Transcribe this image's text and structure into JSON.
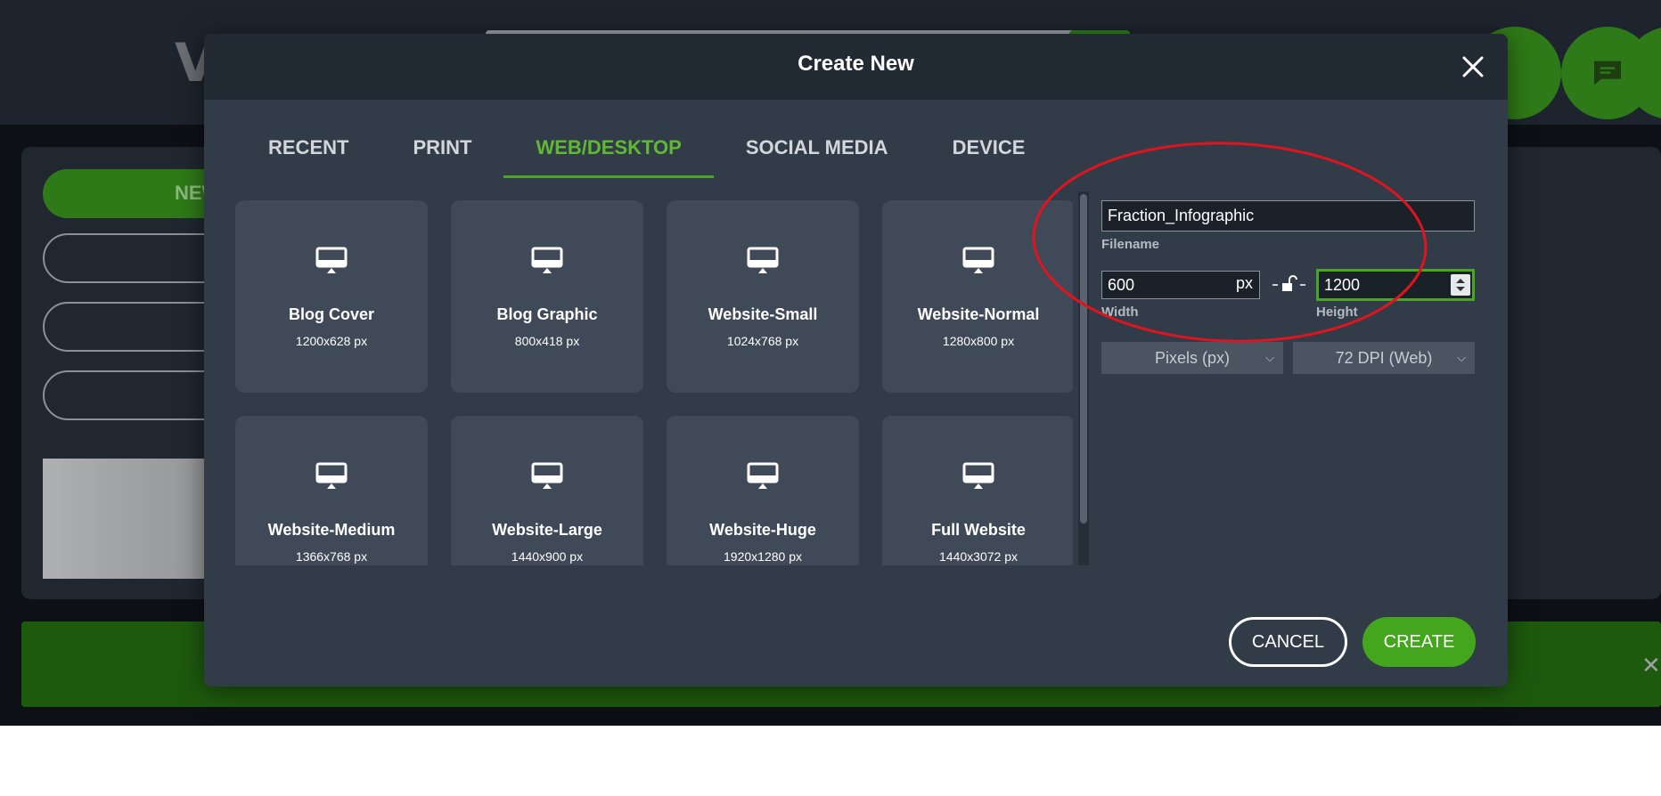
{
  "background_app": {
    "logo_text": "V",
    "new_button_label": "NEW"
  },
  "modal": {
    "title": "Create New",
    "close_icon": "close-icon"
  },
  "tabs": [
    {
      "label": "RECENT",
      "active": false
    },
    {
      "label": "PRINT",
      "active": false
    },
    {
      "label": "WEB/DESKTOP",
      "active": true
    },
    {
      "label": "SOCIAL MEDIA",
      "active": false
    },
    {
      "label": "DEVICE",
      "active": false
    }
  ],
  "presets": [
    {
      "name": "Blog Cover",
      "size": "1200x628 px",
      "icon": "desktop-icon"
    },
    {
      "name": "Blog Graphic",
      "size": "800x418 px",
      "icon": "desktop-icon"
    },
    {
      "name": "Website-Small",
      "size": "1024x768 px",
      "icon": "desktop-icon"
    },
    {
      "name": "Website-Normal",
      "size": "1280x800 px",
      "icon": "desktop-icon"
    },
    {
      "name": "Website-Medium",
      "size": "1366x768 px",
      "icon": "desktop-icon"
    },
    {
      "name": "Website-Large",
      "size": "1440x900 px",
      "icon": "desktop-icon"
    },
    {
      "name": "Website-Huge",
      "size": "1920x1280 px",
      "icon": "desktop-icon"
    },
    {
      "name": "Full Website",
      "size": "1440x3072 px",
      "icon": "desktop-icon"
    }
  ],
  "form": {
    "filename_value": "Fraction_Infographic",
    "filename_label": "Filename",
    "width_value": "600",
    "width_unit": "px",
    "width_label": "Width",
    "height_value": "1200",
    "height_label": "Height",
    "units_selected": "Pixels (px)",
    "dpi_selected": "72 DPI (Web)",
    "lock_icon": "unlock-icon"
  },
  "actions": {
    "cancel_label": "CANCEL",
    "create_label": "CREATE"
  },
  "colors": {
    "accent_green": "#43a61d",
    "active_tab": "#5fb932",
    "modal_bg": "#323c49",
    "header_bg": "#222a34",
    "tile_bg": "#3f4957",
    "annotation_red": "#e0141e"
  }
}
